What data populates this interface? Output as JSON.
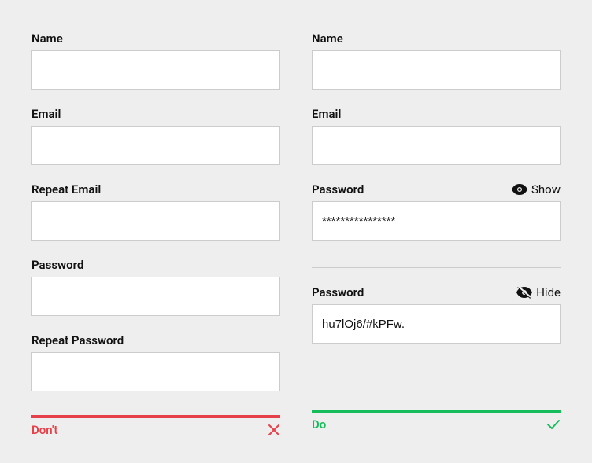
{
  "left": {
    "fields": {
      "name": {
        "label": "Name",
        "value": ""
      },
      "email": {
        "label": "Email",
        "value": ""
      },
      "repeat_email": {
        "label": "Repeat Email",
        "value": ""
      },
      "password": {
        "label": "Password",
        "value": ""
      },
      "repeat_password": {
        "label": "Repeat Password",
        "value": ""
      }
    },
    "footer": {
      "label": "Don't"
    }
  },
  "right": {
    "fields": {
      "name": {
        "label": "Name",
        "value": ""
      },
      "email": {
        "label": "Email",
        "value": ""
      },
      "password_masked": {
        "label": "Password",
        "toggle": "Show",
        "value": "****************"
      },
      "password_plain": {
        "label": "Password",
        "toggle": "Hide",
        "value": "hu7lOj6/#kPFw."
      }
    },
    "footer": {
      "label": "Do"
    }
  }
}
